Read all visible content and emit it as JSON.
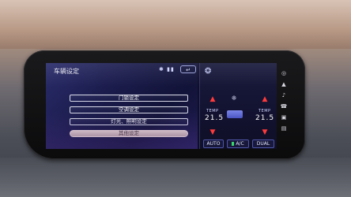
{
  "settings": {
    "title": "车辆设定",
    "status_icons": "✱ ▮▮",
    "back_label": "↵",
    "items": [
      {
        "label": "门锁设定"
      },
      {
        "label": "空调设定"
      },
      {
        "label": "灯光、照明设定"
      },
      {
        "label": "其他设定"
      }
    ]
  },
  "climate": {
    "left_temp_label": "TEMP",
    "left_temp_value": "21.5",
    "right_temp_label": "TEMP",
    "right_temp_value": "21.5",
    "auto_label": "AUTO",
    "ac_label": "A/C",
    "dual_label": "DUAL",
    "seat_icon": "❂",
    "fan_icon": "❈",
    "arrow_up": "▲",
    "arrow_down": "▼",
    "accent": "#ff3a3a",
    "ac_indicator": "#38d86b"
  },
  "side_icons": [
    "◎",
    "▲",
    "♪",
    "☎",
    "▣",
    "▤"
  ]
}
